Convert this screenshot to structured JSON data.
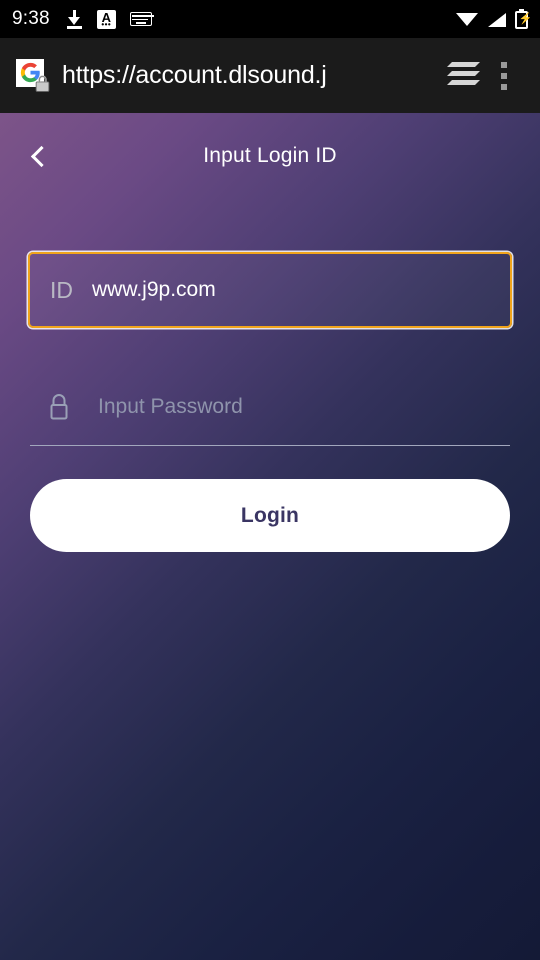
{
  "status_bar": {
    "time": "9:38",
    "left_icons": [
      {
        "name": "download-icon",
        "label": "download"
      },
      {
        "name": "caption-a-icon",
        "label": "A"
      },
      {
        "name": "keyboard-icon",
        "label": "keyboard"
      }
    ],
    "right_icons": [
      {
        "name": "wifi-icon",
        "label": "wifi"
      },
      {
        "name": "cellular-signal-icon",
        "label": "signal"
      },
      {
        "name": "battery-charging-icon",
        "label": "battery charging"
      }
    ],
    "background_color": "#000000"
  },
  "browser_bar": {
    "url": "https://account.dlsound.j",
    "favicon_name": "google-favicon",
    "security_badge_name": "lock-badge-icon",
    "tabs_label": "tabs",
    "menu_label": "more options",
    "background_color": "#1b1b1b"
  },
  "app": {
    "header": {
      "title": "Input Login ID",
      "back_label": "Back"
    },
    "gradient_from": "#7d5489",
    "gradient_to": "#141a36",
    "id_field": {
      "label": "ID",
      "value": "www.j9p.com",
      "focused": true,
      "focus_border_color": "#f0a41c"
    },
    "password_field": {
      "placeholder": "Input Password",
      "value": "",
      "icon_name": "lock-icon",
      "underline_color": "#a2a7bd"
    },
    "login_button": {
      "label": "Login",
      "background_color": "#ffffff",
      "text_color": "#3a3563"
    }
  }
}
